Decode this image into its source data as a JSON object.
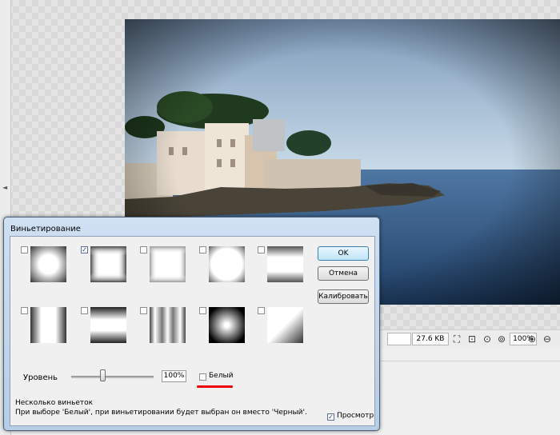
{
  "app": {
    "status": {
      "file_size": "27.6 KB",
      "zoom": "100%"
    }
  },
  "dialog": {
    "title": "Виньетирование",
    "buttons": {
      "ok": "OK",
      "cancel": "Отмена",
      "calibrate": "Калибровать"
    },
    "presets": [
      {
        "id": 1,
        "checked": false,
        "icon": "soft-round-vignette-icon"
      },
      {
        "id": 2,
        "checked": true,
        "icon": "square-vignette-icon"
      },
      {
        "id": 3,
        "checked": false,
        "icon": "soft-square-vignette-icon"
      },
      {
        "id": 4,
        "checked": false,
        "icon": "corner-vignette-icon"
      },
      {
        "id": 5,
        "checked": false,
        "icon": "top-bottom-soft-vignette-icon"
      },
      {
        "id": 6,
        "checked": false,
        "icon": "left-right-vignette-icon"
      },
      {
        "id": 7,
        "checked": false,
        "icon": "top-bottom-vignette-icon"
      },
      {
        "id": 8,
        "checked": false,
        "icon": "vertical-stripes-vignette-icon"
      },
      {
        "id": 9,
        "checked": false,
        "icon": "dark-round-vignette-icon"
      },
      {
        "id": 10,
        "checked": false,
        "icon": "diagonal-vignette-icon"
      }
    ],
    "level": {
      "label": "Уровень",
      "value_text": "100%",
      "slider_level": 0.4
    },
    "white": {
      "label": "Белый",
      "checked": false
    },
    "description": {
      "line1": "Несколько виньеток",
      "line2": "При выборе 'Белый', при виньетировании будет выбран он вместо 'Черный'."
    },
    "preview": {
      "label": "Просмотр",
      "checked": true
    }
  }
}
